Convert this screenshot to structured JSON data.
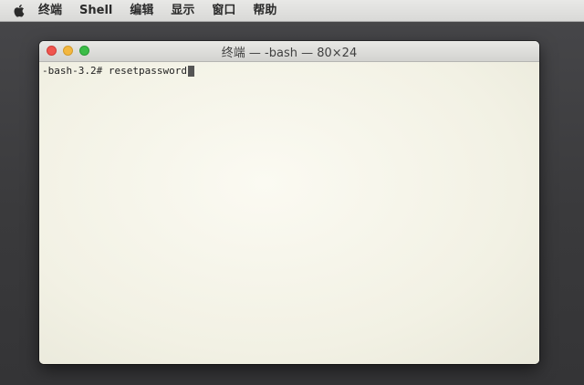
{
  "menubar": {
    "apple_icon": "apple-logo-icon",
    "items": [
      "终端",
      "Shell",
      "编辑",
      "显示",
      "窗口",
      "帮助"
    ]
  },
  "window": {
    "title": "终端 — -bash — 80×24"
  },
  "terminal": {
    "prompt": "-bash-3.2#",
    "command": "resetpassword"
  },
  "colors": {
    "close": "#f0554e",
    "minimize": "#f3b73f",
    "zoom": "#3bbd48",
    "terminal_background": "#f4f3e8"
  }
}
